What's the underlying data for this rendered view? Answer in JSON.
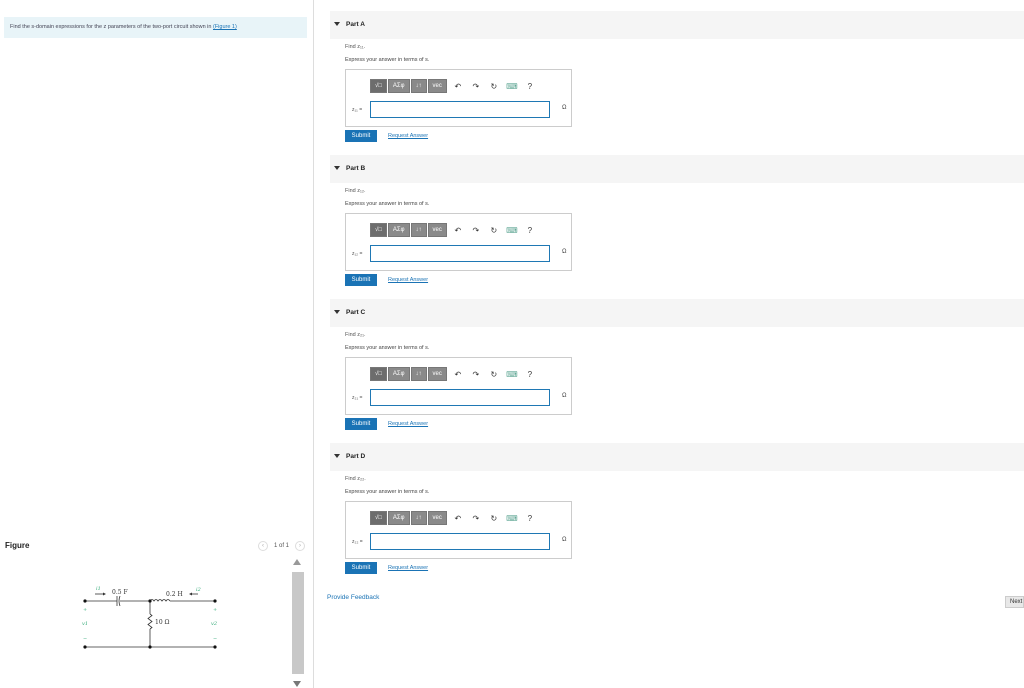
{
  "prompt": {
    "text": "Find the s-domain expressions for the z parameters of the two-port circuit shown in ",
    "link": "(Figure 1)"
  },
  "figure": {
    "label": "Figure",
    "pager": "1 of 1",
    "circuit": {
      "i1": "i1",
      "i2": "i2",
      "v1": "v1",
      "v2": "v2",
      "capacitor": "0.5 F",
      "inductor": "0.2 H",
      "resistor": "10 Ω",
      "plus": "+",
      "minus": "−"
    }
  },
  "toolbar": {
    "sqrt": "√□",
    "greek": "ΑΣφ",
    "arrows": "↓↑",
    "vec": "vec",
    "undo": "↶",
    "redo": "↷",
    "reset": "↻",
    "keyboard": "⌨",
    "help": "?"
  },
  "parts": [
    {
      "title": "Part A",
      "find": "Find z₁₁.",
      "express": "Express your answer in terms of s.",
      "var": "z₁₁ =",
      "unit": "Ω"
    },
    {
      "title": "Part B",
      "find": "Find z₁₂.",
      "express": "Express your answer in terms of s.",
      "var": "z₁₂ =",
      "unit": "Ω"
    },
    {
      "title": "Part C",
      "find": "Find z₂₁.",
      "express": "Express your answer in terms of s.",
      "var": "z₂₁ =",
      "unit": "Ω"
    },
    {
      "title": "Part D",
      "find": "Find z₂₂.",
      "express": "Express your answer in terms of s.",
      "var": "z₂₂ =",
      "unit": "Ω"
    }
  ],
  "buttons": {
    "submit": "Submit",
    "request": "Request Answer"
  },
  "footer": {
    "feedback": "Provide Feedback",
    "next": "Next"
  }
}
